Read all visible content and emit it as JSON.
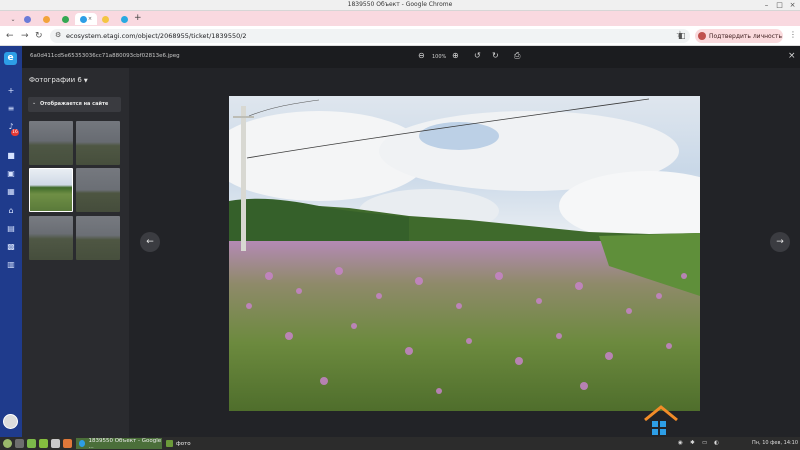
{
  "window": {
    "title": "1839550 Объект - Google Chrome"
  },
  "tabs": [
    {
      "id": "t1",
      "favicon_color": "#6a7bd8"
    },
    {
      "id": "t2",
      "favicon_color": "#f2a33a"
    },
    {
      "id": "t3",
      "favicon_color": "#34a853"
    },
    {
      "id": "t4",
      "favicon_color": "#2d9ee6",
      "active": true
    },
    {
      "id": "t5",
      "favicon_color": "#f4c542"
    },
    {
      "id": "t6",
      "favicon_color": "#29a9e1"
    }
  ],
  "address": {
    "url": "ecosystem.etagi.com/object/2068955/ticket/1839550/2",
    "verify_label": "Подтвердить личность"
  },
  "viewer": {
    "filename": "6a0d411cd5e65353036cc71a880093cbf02813e6.jpeg",
    "zoom": "100%",
    "photos_header": "Фотографии 6",
    "section_label": "Отображается на сайте"
  },
  "rail": {
    "notification_count": "16"
  },
  "taskbar": {
    "windows": [
      {
        "label": "1839550 Объект - Google ...",
        "active": true
      },
      {
        "label": "фото",
        "active": false
      }
    ],
    "clock": "Пн, 10 фев, 14:10"
  },
  "colors": {
    "accent": "#1f3b8c",
    "verify_bg": "#fadadd",
    "tabstrip": "#f9d9e0"
  }
}
